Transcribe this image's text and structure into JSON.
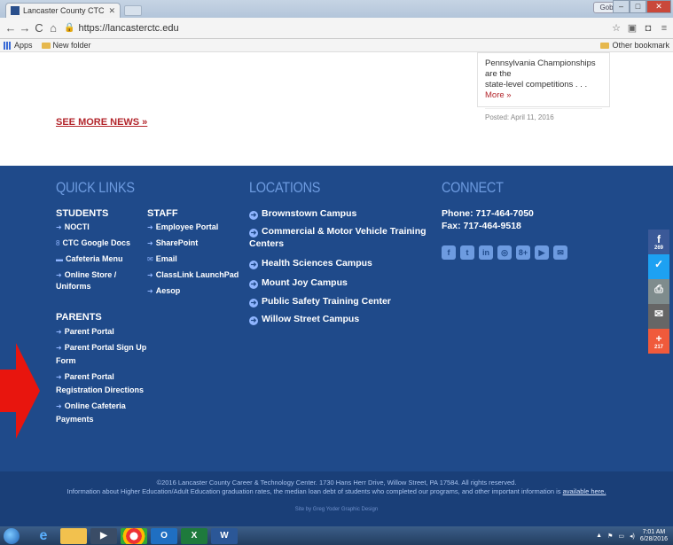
{
  "browser": {
    "tab_title": "Lancaster County CTC - C",
    "url": "https://lancasterctc.edu",
    "user_chip": "Gob",
    "bookmarks": [
      {
        "label": "Apps"
      },
      {
        "label": "New folder"
      }
    ],
    "other_bookmarks": "Other bookmark"
  },
  "news": {
    "excerpt_top": "Pennsylvania Championships are the",
    "excerpt_bottom": "state-level competitions . . .",
    "more_label": "More »",
    "posted": "Posted: April 11, 2016",
    "see_more": "SEE MORE NEWS »"
  },
  "quick_links": {
    "title": "QUICK LINKS",
    "students_title": "STUDENTS",
    "students": [
      "NOCTI",
      "CTC Google Docs",
      "Cafeteria Menu",
      "Online Store /",
      "Uniforms"
    ],
    "staff_title": "STAFF",
    "staff": [
      "Employee Portal",
      "SharePoint",
      "Email",
      "ClassLink LaunchPad",
      "Aesop"
    ],
    "parents_title": "PARENTS",
    "parents": [
      "Parent Portal",
      "Parent Portal Sign Up",
      "Form",
      "Parent Portal",
      "Registration Directions",
      "Online Cafeteria",
      "Payments"
    ]
  },
  "locations": {
    "title": "LOCATIONS",
    "items": [
      "Brownstown Campus",
      "Commercial & Motor Vehicle Training",
      "Centers",
      "Health Sciences Campus",
      "Mount Joy Campus",
      "Public Safety Training Center",
      "Willow Street Campus"
    ]
  },
  "connect": {
    "title": "CONNECT",
    "phone": "Phone: 717-464-7050",
    "fax": "Fax: 717-464-9518",
    "icons": [
      "facebook-icon",
      "twitter-icon",
      "linkedin-icon",
      "instagram-icon",
      "google-plus-icon",
      "youtube-icon",
      "email-icon"
    ]
  },
  "share_bar": {
    "facebook_count": "269",
    "plus_count": "217",
    "colors": {
      "facebook": "#3b5998",
      "twitter": "#1da1f2",
      "print": "#7f8c8d",
      "email": "#666666",
      "plus": "#f05a3b"
    }
  },
  "footer_bottom": {
    "copyright": "©2016 Lancaster County Career & Technology Center. 1730 Hans Herr Drive, Willow Street, PA 17584. All rights reserved.",
    "info": "Information about Higher Education/Adult Education graduation rates, the median loan debt of students who completed our programs, and other important information is",
    "info_link": "available here.",
    "credit": "Site by Greg Yoder Graphic Design"
  },
  "taskbar": {
    "time": "7:01 AM",
    "date": "6/28/2016"
  },
  "colors": {
    "footer_blue": "#1f4a8a",
    "heading_blue": "#6d9be0",
    "accent_red": "#b3262c"
  }
}
